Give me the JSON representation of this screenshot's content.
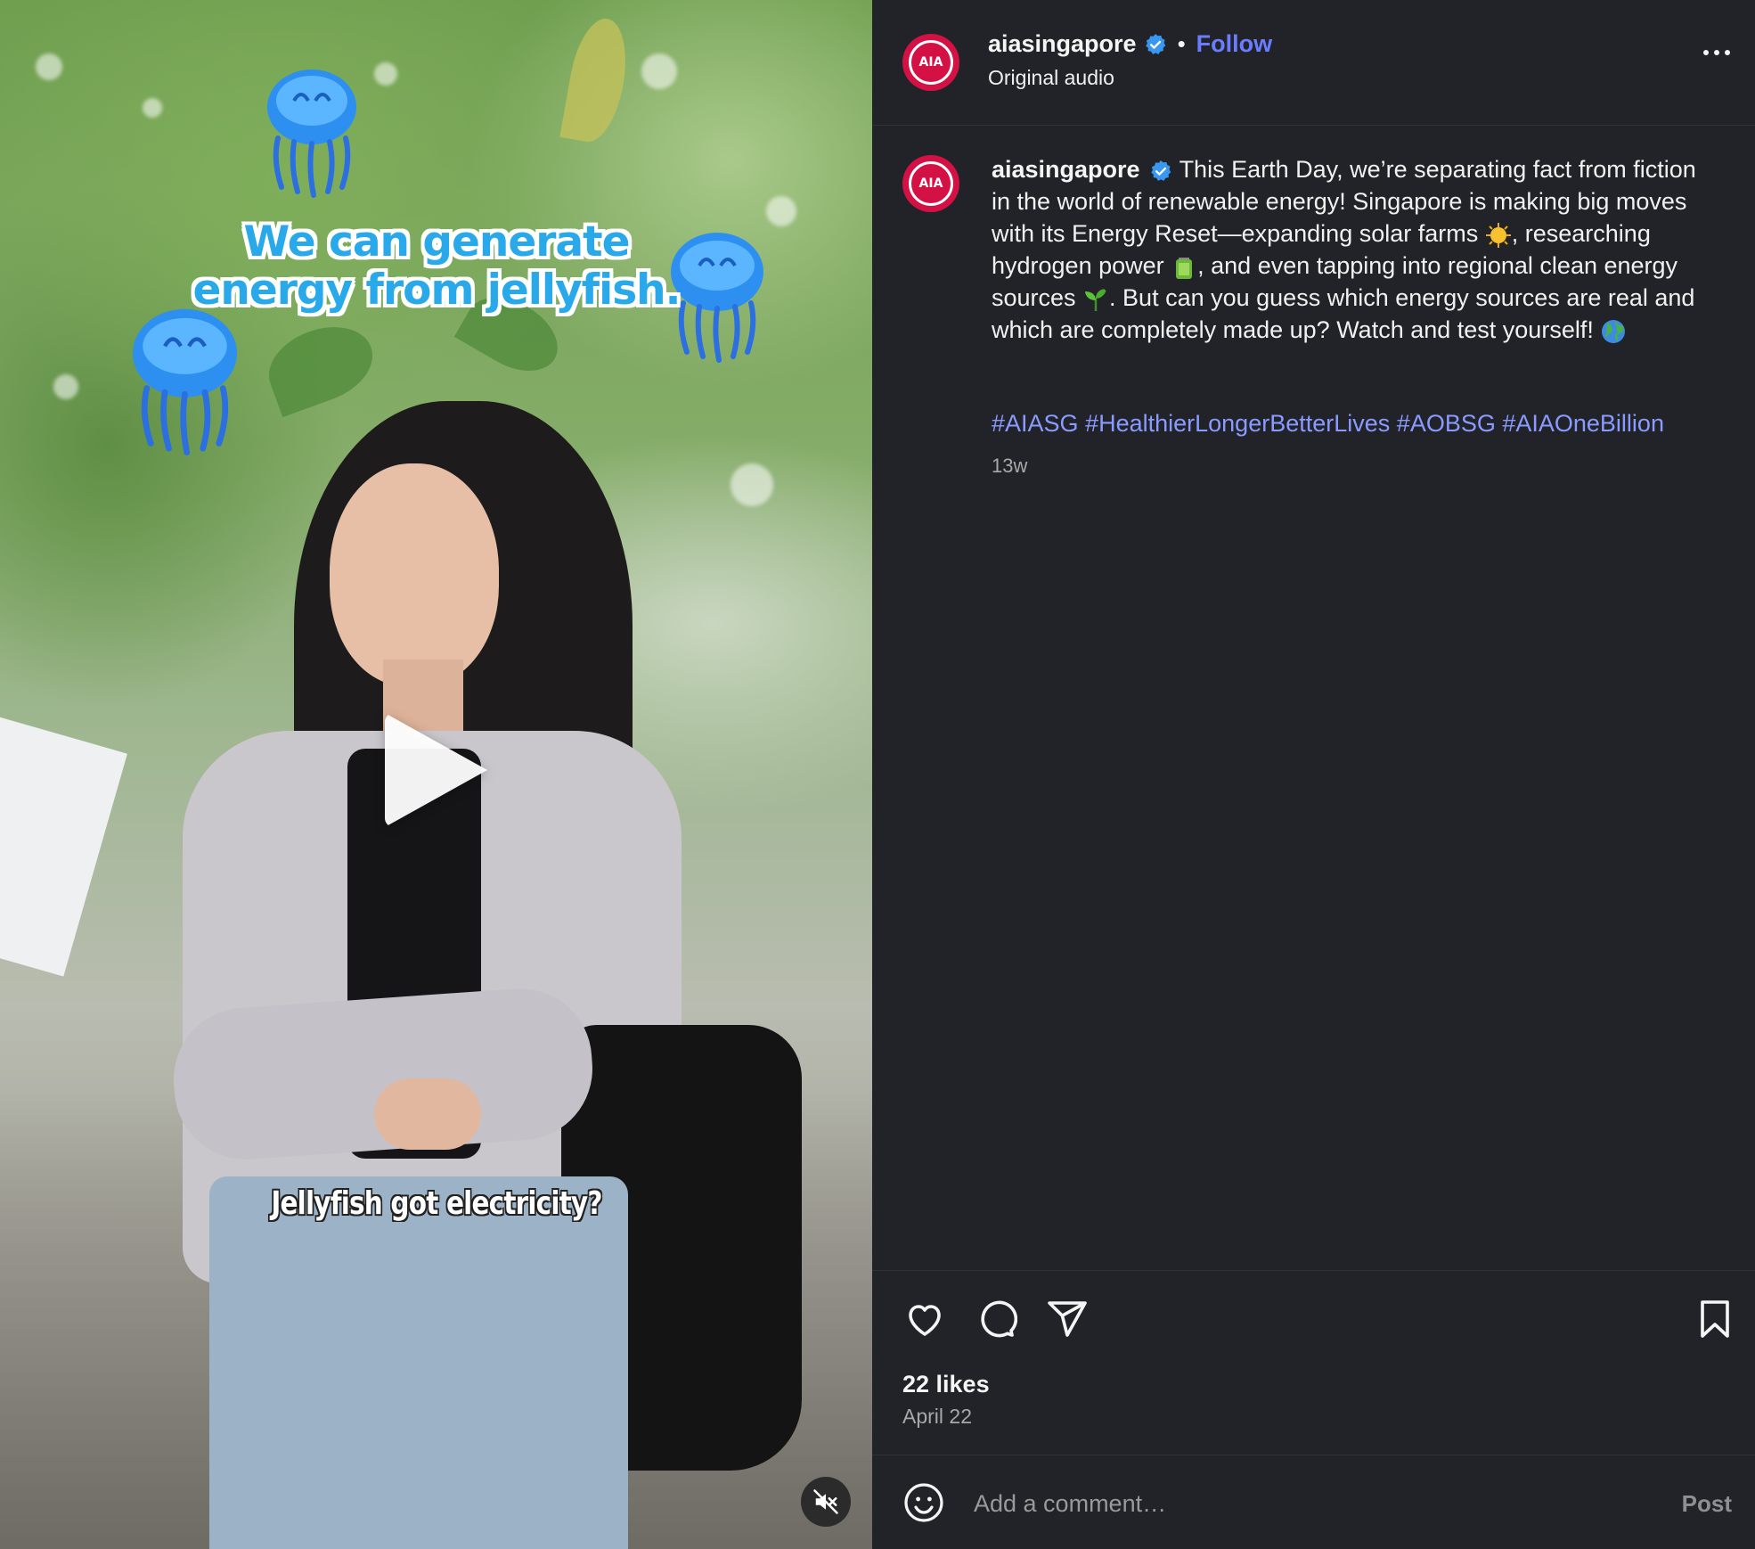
{
  "video": {
    "headline": "We can generate energy from jellyfish.",
    "subtitle": "Jellyfish got electricity?"
  },
  "header": {
    "username": "aiasingapore",
    "separator": "•",
    "follow_label": "Follow",
    "audio_label": "Original audio",
    "avatar_text": "AIA"
  },
  "caption": {
    "username": "aiasingapore",
    "segments": [
      "This Earth Day, we’re separating fact from fiction in the world of renewable energy! Singapore is making big moves with its Energy Reset—expanding solar farms ",
      ", researching hydrogen power ",
      ", and even tapping into regional clean energy sources ",
      ". But can you guess which energy sources are real and which are completely made up? Watch and test yourself! "
    ],
    "hashtags": [
      "#AIASG",
      "#HealthierLongerBetterLives",
      "#AOBSG",
      "#AIAOneBillion"
    ],
    "time_ago": "13w"
  },
  "engagement": {
    "likes": "22 likes",
    "date": "April 22"
  },
  "comment": {
    "placeholder": "Add a comment…",
    "post_label": "Post"
  },
  "colors": {
    "panel_bg": "#212328",
    "accent_link": "#6b7dff",
    "hashtag": "#8a9bff",
    "brand": "#d31145",
    "verified": "#3897f0"
  }
}
